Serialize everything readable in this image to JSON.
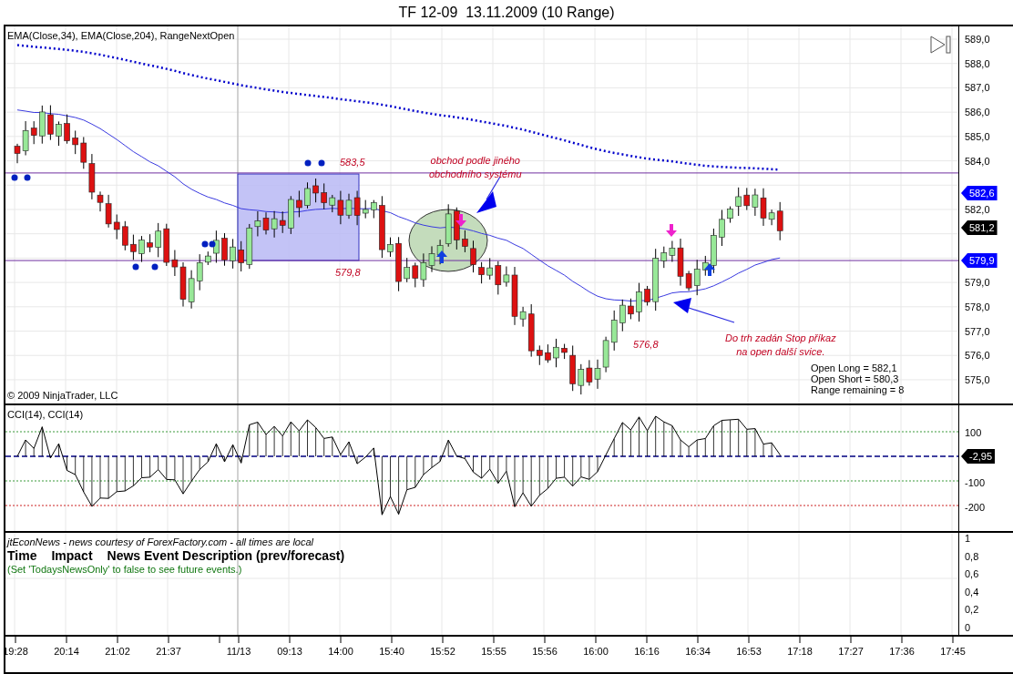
{
  "title": "TF 12-09  13.11.2009 (10 Range)",
  "price_panel": {
    "indicator_label": "EMA(Close,34), EMA(Close,204), RangeNextOpen",
    "y_axis": [
      "589,0",
      "588,0",
      "587,0",
      "586,0",
      "585,0",
      "584,0",
      "582,0",
      "579,0",
      "578,0",
      "577,0",
      "576,0",
      "575,0"
    ],
    "price_markers": [
      {
        "value": "582,6",
        "color": "#0000ff"
      },
      {
        "value": "581,2",
        "color": "#000000"
      },
      {
        "value": "579,9",
        "color": "#0000ff"
      }
    ],
    "annotations": [
      {
        "kind": "price",
        "text": "583,5"
      },
      {
        "kind": "price",
        "text": "579,8"
      },
      {
        "kind": "note",
        "lines": [
          "obchod podle jiného",
          "obchodního systému"
        ]
      },
      {
        "kind": "price",
        "text": "576,8"
      },
      {
        "kind": "note",
        "lines": [
          "Do trh zadán Stop příkaz",
          "na open další svice."
        ]
      }
    ],
    "stats": [
      "Open Long = 582,1",
      "Open Short = 580,3",
      "Range remaining = 8"
    ],
    "copyright": "© 2009 NinjaTrader, LLC"
  },
  "cci_panel": {
    "indicator_label": "CCI(14), CCI(14)",
    "y_axis": [
      "100",
      "-100",
      "-200"
    ],
    "value_marker": "-2,95"
  },
  "news_panel": {
    "source": "jtEconNews - news courtesy of ForexFactory.com - all times are local",
    "columns": [
      "Time",
      "Impact",
      "News Event Description (prev/forecast)"
    ],
    "note": "(Set 'TodaysNewsOnly' to false to see future events.)",
    "y_axis": [
      "1",
      "0,8",
      "0,6",
      "0,4",
      "0,2",
      "0"
    ]
  },
  "x_axis": [
    "19:28",
    "20:14",
    "21:02",
    "21:37",
    "11/13",
    "09:13",
    "14:00",
    "15:40",
    "15:52",
    "15:55",
    "15:56",
    "16:00",
    "16:16",
    "16:34",
    "16:53",
    "17:18",
    "17:27",
    "17:36",
    "17:45"
  ]
}
